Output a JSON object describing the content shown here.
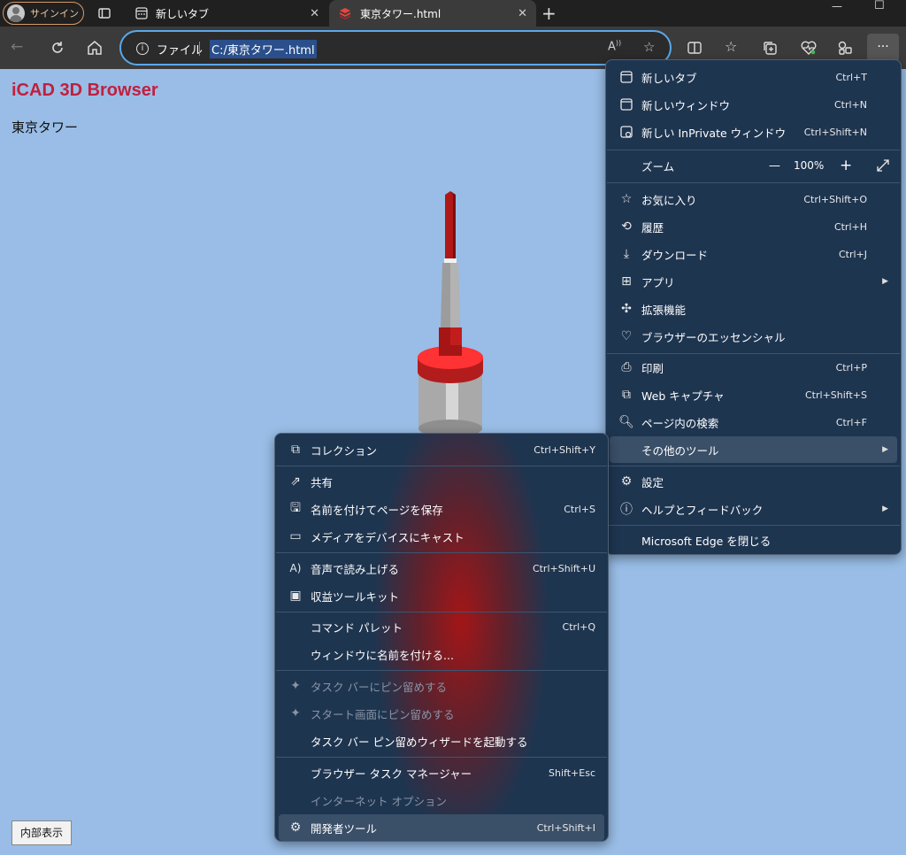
{
  "browser": {
    "profile_label": "サインイン",
    "tabs": [
      {
        "label": "新しいタブ",
        "close": "✕"
      },
      {
        "label": "東京タワー.html",
        "close": "✕"
      }
    ],
    "new_tab": "+",
    "address": {
      "prefix": "ファイル",
      "url": "C:/東京タワー.html"
    },
    "more_button": "···"
  },
  "page": {
    "title": "iCAD 3D Browser",
    "subtitle": "東京タワー",
    "inner_button": "内部表示"
  },
  "main_menu": {
    "items": [
      {
        "label": "新しいタブ",
        "shortcut": "Ctrl+T"
      },
      {
        "label": "新しいウィンドウ",
        "shortcut": "Ctrl+N"
      },
      {
        "label": "新しい InPrivate ウィンドウ",
        "shortcut": "Ctrl+Shift+N"
      },
      {
        "label": "お気に入り",
        "shortcut": "Ctrl+Shift+O"
      },
      {
        "label": "履歴",
        "shortcut": "Ctrl+H"
      },
      {
        "label": "ダウンロード",
        "shortcut": "Ctrl+J"
      },
      {
        "label": "アプリ",
        "shortcut": ""
      },
      {
        "label": "拡張機能",
        "shortcut": ""
      },
      {
        "label": "ブラウザーのエッセンシャル",
        "shortcut": ""
      },
      {
        "label": "印刷",
        "shortcut": "Ctrl+P"
      },
      {
        "label": "Web キャプチャ",
        "shortcut": "Ctrl+Shift+S"
      },
      {
        "label": "ページ内の検索",
        "shortcut": "Ctrl+F"
      },
      {
        "label": "その他のツール",
        "shortcut": ""
      },
      {
        "label": "設定",
        "shortcut": ""
      },
      {
        "label": "ヘルプとフィードバック",
        "shortcut": ""
      },
      {
        "label": "Microsoft Edge を閉じる",
        "shortcut": ""
      }
    ],
    "zoom": {
      "label": "ズーム",
      "minus": "—",
      "value": "100%",
      "plus": "+"
    }
  },
  "sub_menu": {
    "items": [
      {
        "label": "コレクション",
        "shortcut": "Ctrl+Shift+Y"
      },
      {
        "label": "共有",
        "shortcut": ""
      },
      {
        "label": "名前を付けてページを保存",
        "shortcut": "Ctrl+S"
      },
      {
        "label": "メディアをデバイスにキャスト",
        "shortcut": ""
      },
      {
        "label": "音声で読み上げる",
        "shortcut": "Ctrl+Shift+U"
      },
      {
        "label": "収益ツールキット",
        "shortcut": ""
      },
      {
        "label": "コマンド パレット",
        "shortcut": "Ctrl+Q"
      },
      {
        "label": "ウィンドウに名前を付ける...",
        "shortcut": ""
      },
      {
        "label": "タスク バーにピン留めする",
        "shortcut": ""
      },
      {
        "label": "スタート画面にピン留めする",
        "shortcut": ""
      },
      {
        "label": "タスク バー ピン留めウィザードを起動する",
        "shortcut": ""
      },
      {
        "label": "ブラウザー タスク マネージャー",
        "shortcut": "Shift+Esc"
      },
      {
        "label": "インターネット オプション",
        "shortcut": ""
      },
      {
        "label": "開発者ツール",
        "shortcut": "Ctrl+Shift+I"
      }
    ]
  },
  "colors": {
    "accent": "#5aa8e8",
    "menu_bg": "#1e3550",
    "page_bg": "#99bde6",
    "title": "#c02040"
  }
}
